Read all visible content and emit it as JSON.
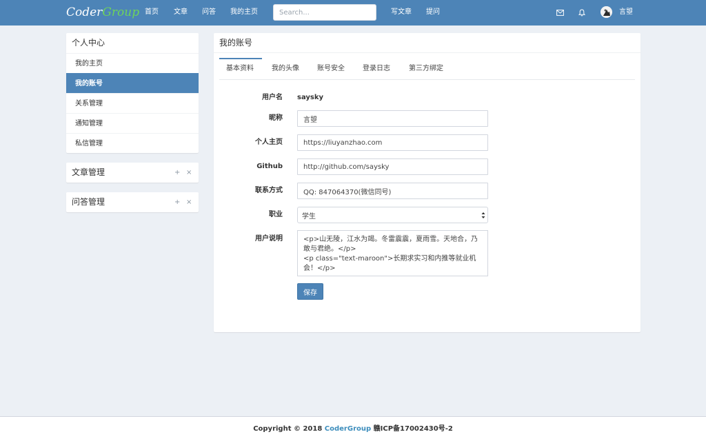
{
  "brand": {
    "part1": "Coder",
    "part2": "Group"
  },
  "nav": {
    "links": [
      "首页",
      "文章",
      "问答",
      "我的主页"
    ],
    "search_placeholder": "Search...",
    "actions": [
      "写文章",
      "提问"
    ],
    "user_name": "言曌"
  },
  "sidebar": {
    "personal": {
      "title": "个人中心",
      "items": [
        "我的主页",
        "我的账号",
        "关系管理",
        "通知管理",
        "私信管理"
      ],
      "active": "我的账号"
    },
    "articles": {
      "title": "文章管理"
    },
    "qa": {
      "title": "问答管理"
    },
    "tool_add": "+",
    "tool_close": "×"
  },
  "main": {
    "title": "我的账号",
    "tabs": [
      "基本资料",
      "我的头像",
      "账号安全",
      "登录日志",
      "第三方绑定"
    ],
    "active_tab": "基本资料",
    "form": {
      "username_label": "用户名",
      "username_value": "saysky",
      "nickname_label": "昵称",
      "nickname_value": "言曌",
      "homepage_label": "个人主页",
      "homepage_value": "https://liuyanzhao.com",
      "github_label": "Github",
      "github_value": "http://github.com/saysky",
      "contact_label": "联系方式",
      "contact_value": "QQ: 847064370(微信同号)",
      "job_label": "职业",
      "job_value": "学生",
      "bio_label": "用户说明",
      "bio_value": "<p>山无陵，江水为竭。冬雷震震，夏雨雪。天地合，乃敢与君绝。</p>\n<p class=\"text-maroon\">长期求实习和内推等就业机会！</p>",
      "save_label": "保存"
    }
  },
  "footer": {
    "prefix": "Copyright © 2018 ",
    "link": "CoderGroup",
    "suffix": " 赣ICP备17002430号-2"
  },
  "colors": {
    "navbar": "#4d84b7",
    "brand_accent": "#6ed35c",
    "background": "#ecf0f5",
    "link": "#3c8dbc"
  }
}
